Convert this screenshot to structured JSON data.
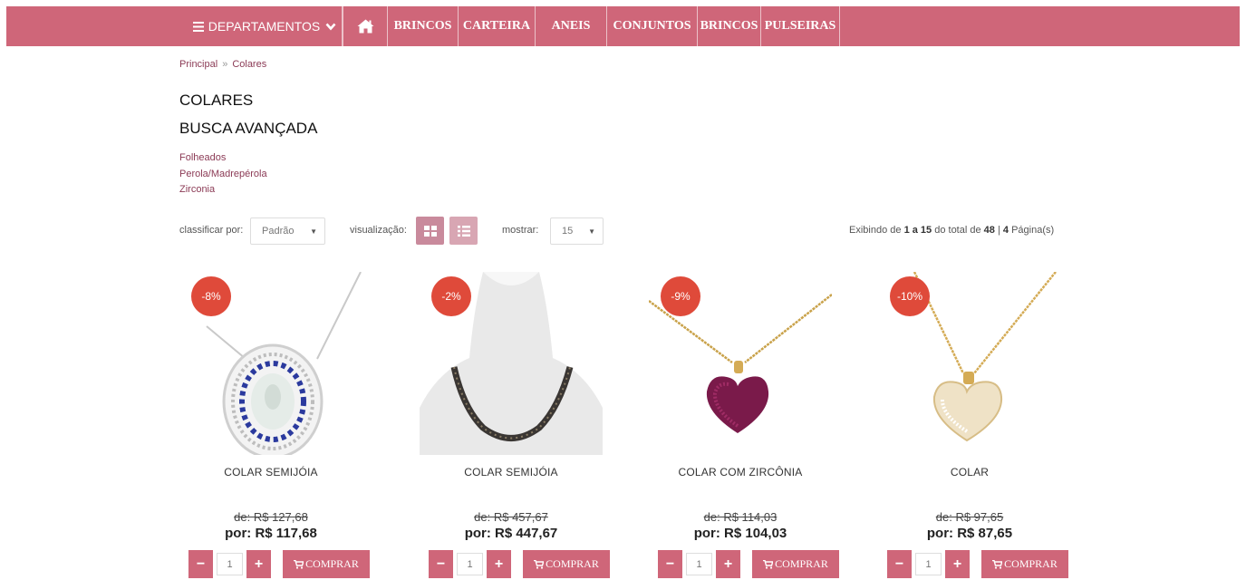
{
  "nav": {
    "departments_label": "DEPARTAMENTOS",
    "home_icon": "home-icon",
    "items": [
      "BRINCOS",
      "CARTEIRA",
      "ANEIS",
      "CONJUNTOS",
      "BRINCOS",
      "PULSEIRAS"
    ]
  },
  "breadcrumb": {
    "home": "Principal",
    "current": "Colares",
    "separator": "»"
  },
  "page_title": "COLARES",
  "advanced_search_title": "BUSCA AVANÇADA",
  "filters": [
    "Folheados",
    "Perola/Madrepérola",
    "Zirconia"
  ],
  "toolbar": {
    "sort_label": "classificar por:",
    "sort_value": "Padrão",
    "view_label": "visualização:",
    "show_label": "mostrar:",
    "show_value": "15",
    "info": {
      "prefix": "Exibindo de",
      "from": "1 a 15",
      "mid": "do total de",
      "total": "48",
      "sep": "|",
      "pages": "4",
      "suffix": "Página(s)"
    }
  },
  "products": [
    {
      "badge": "-8%",
      "name": "COLAR  SEMIJÓIA",
      "old_price": "de: R$ 127,68",
      "new_price": "por: R$ 117,68",
      "qty": "1",
      "buy": "COMPRAR"
    },
    {
      "badge": "-2%",
      "name": "COLAR SEMIJÓIA",
      "old_price": "de: R$ 457,67",
      "new_price": "por: R$ 447,67",
      "qty": "1",
      "buy": "COMPRAR"
    },
    {
      "badge": "-9%",
      "name": "COLAR COM ZIRCÔNIA",
      "old_price": "de: R$ 114,03",
      "new_price": "por: R$ 104,03",
      "qty": "1",
      "buy": "COMPRAR"
    },
    {
      "badge": "-10%",
      "name": "COLAR",
      "old_price": "de: R$ 97,65",
      "new_price": "por: R$ 87,65",
      "qty": "1",
      "buy": "COMPRAR"
    }
  ],
  "colors": {
    "brand": "#cf6679",
    "badge": "#df4a3a",
    "link": "#8b3a55"
  }
}
